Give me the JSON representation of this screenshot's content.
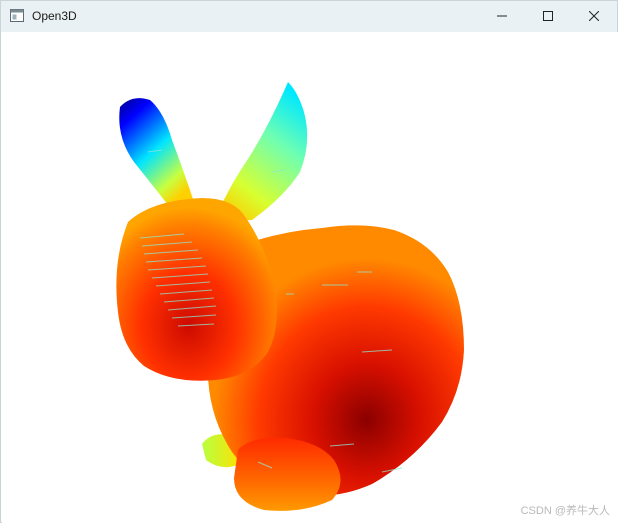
{
  "window": {
    "title": "Open3D",
    "icon": "app-window-icon",
    "controls": {
      "minimize_icon": "minimize-icon",
      "maximize_icon": "maximize-icon",
      "close_icon": "close-icon"
    }
  },
  "viewport": {
    "background": "#ffffff",
    "content": "point-cloud-render",
    "colormap": [
      "#00008b",
      "#0000ff",
      "#00ffff",
      "#ffff00",
      "#ff8800",
      "#ff2200",
      "#8b0000"
    ]
  },
  "watermark": {
    "text": "CSDN @养牛大人"
  }
}
